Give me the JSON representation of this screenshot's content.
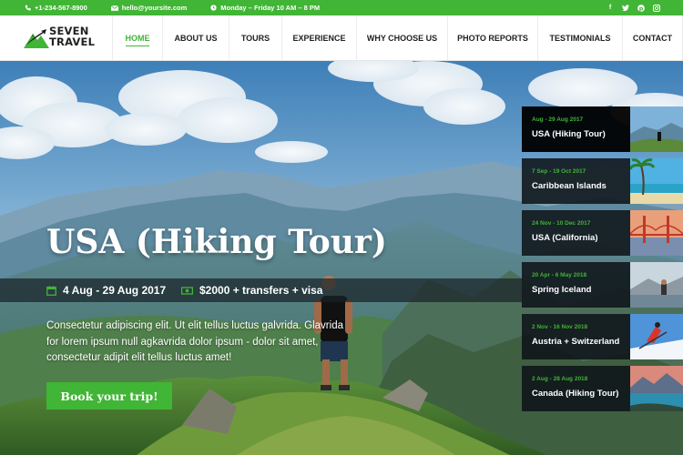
{
  "topbar": {
    "phone": "+1-234-567-8900",
    "email": "hello@yoursite.com",
    "hours": "Monday – Friday 10 AM – 8 PM",
    "social": [
      "facebook-icon",
      "twitter-icon",
      "pinterest-icon",
      "instagram-icon"
    ]
  },
  "brand": {
    "line1": "SEVEN",
    "line2": "TRAVEL"
  },
  "nav": {
    "items": [
      "HOME",
      "ABOUT US",
      "TOURS",
      "EXPERIENCE",
      "WHY CHOOSE US",
      "PHOTO REPORTS",
      "TESTIMONIALS",
      "CONTACT"
    ],
    "active": "HOME"
  },
  "hero": {
    "title": "USA (Hiking Tour)",
    "dates": "4 Aug - 29 Aug 2017",
    "price": "$2000 + transfers + visa",
    "description": "Consectetur adipiscing elit. Ut elit tellus luctus galvrida. Glavrida for lorem ipsum null agkavrida dolor ipsum - dolor sit amet, consectetur adipit elit tellus luctus amet!",
    "cta": "Book your trip!"
  },
  "tours": [
    {
      "date": "Aug - 29 Aug 2017",
      "name": "USA (Hiking Tour)"
    },
    {
      "date": "7 Sep - 19 Oct 2017",
      "name": "Caribbean Islands"
    },
    {
      "date": "24 Nov - 10 Dec 2017",
      "name": "USA (California)"
    },
    {
      "date": "20 Apr - 6 May 2018",
      "name": "Spring Iceland"
    },
    {
      "date": "2 Nov - 16 Nov 2018",
      "name": "Austria + Switzerland"
    },
    {
      "date": "2 Aug - 28 Aug 2018",
      "name": "Canada (Hiking Tour)"
    }
  ],
  "colors": {
    "accent": "#41b535",
    "dark": "#111619"
  }
}
